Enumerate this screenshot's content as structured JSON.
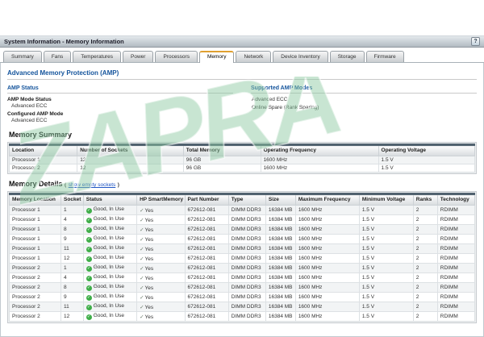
{
  "window": {
    "title": "System Information - Memory Information",
    "help_label": "?"
  },
  "tabs": [
    {
      "label": "Summary"
    },
    {
      "label": "Fans"
    },
    {
      "label": "Temperatures"
    },
    {
      "label": "Power"
    },
    {
      "label": "Processors"
    },
    {
      "label": "Memory",
      "active": true
    },
    {
      "label": "Network"
    },
    {
      "label": "Device Inventory"
    },
    {
      "label": "Storage"
    },
    {
      "label": "Firmware"
    }
  ],
  "amp": {
    "heading": "Advanced Memory Protection (AMP)",
    "status": {
      "heading": "AMP Status",
      "fields": [
        {
          "label": "AMP Mode Status",
          "value": "Advanced ECC"
        },
        {
          "label": "Configured AMP Mode",
          "value": "Advanced ECC"
        }
      ]
    },
    "supported": {
      "heading": "Supported AMP Modes",
      "modes": [
        {
          "name": "Advanced ECC"
        },
        {
          "name": "Online Spare (Rank Sparing)"
        }
      ]
    }
  },
  "memory_summary": {
    "heading": "Memory Summary",
    "columns": [
      {
        "label": "Location"
      },
      {
        "label": "Number of Sockets"
      },
      {
        "label": "Total Memory"
      },
      {
        "label": "Operating Frequency"
      },
      {
        "label": "Operating Voltage"
      }
    ],
    "rows": [
      {
        "location": "Processor 1",
        "sockets": "12",
        "total": "96 GB",
        "freq": "1600 MHz",
        "volt": "1.5 V"
      },
      {
        "location": "Processor 2",
        "sockets": "12",
        "total": "96 GB",
        "freq": "1600 MHz",
        "volt": "1.5 V"
      }
    ]
  },
  "memory_details": {
    "heading": "Memory Details",
    "paren_open": "(",
    "link_label": "show empty sockets",
    "paren_close": ")",
    "columns": [
      {
        "label": "Memory Location"
      },
      {
        "label": "Socket"
      },
      {
        "label": "Status"
      },
      {
        "label": "HP SmartMemory"
      },
      {
        "label": "Part Number"
      },
      {
        "label": "Type"
      },
      {
        "label": "Size"
      },
      {
        "label": "Maximum Frequency"
      },
      {
        "label": "Minimum Voltage"
      },
      {
        "label": "Ranks"
      },
      {
        "label": "Technology"
      }
    ],
    "rows": [
      {
        "location": "Processor 1",
        "socket": "1",
        "status": "Good, In Use",
        "smart": "Yes",
        "part": "672612-081",
        "type": "DIMM DDR3",
        "size": "16384 MB",
        "freq": "1600 MHz",
        "volt": "1.5 V",
        "ranks": "2",
        "tech": "RDIMM"
      },
      {
        "location": "Processor 1",
        "socket": "4",
        "status": "Good, In Use",
        "smart": "Yes",
        "part": "672612-081",
        "type": "DIMM DDR3",
        "size": "16384 MB",
        "freq": "1600 MHz",
        "volt": "1.5 V",
        "ranks": "2",
        "tech": "RDIMM"
      },
      {
        "location": "Processor 1",
        "socket": "8",
        "status": "Good, In Use",
        "smart": "Yes",
        "part": "672612-081",
        "type": "DIMM DDR3",
        "size": "16384 MB",
        "freq": "1600 MHz",
        "volt": "1.5 V",
        "ranks": "2",
        "tech": "RDIMM"
      },
      {
        "location": "Processor 1",
        "socket": "9",
        "status": "Good, In Use",
        "smart": "Yes",
        "part": "672612-081",
        "type": "DIMM DDR3",
        "size": "16384 MB",
        "freq": "1600 MHz",
        "volt": "1.5 V",
        "ranks": "2",
        "tech": "RDIMM"
      },
      {
        "location": "Processor 1",
        "socket": "11",
        "status": "Good, In Use",
        "smart": "Yes",
        "part": "672612-081",
        "type": "DIMM DDR3",
        "size": "16384 MB",
        "freq": "1600 MHz",
        "volt": "1.5 V",
        "ranks": "2",
        "tech": "RDIMM"
      },
      {
        "location": "Processor 1",
        "socket": "12",
        "status": "Good, In Use",
        "smart": "Yes",
        "part": "672612-081",
        "type": "DIMM DDR3",
        "size": "16384 MB",
        "freq": "1600 MHz",
        "volt": "1.5 V",
        "ranks": "2",
        "tech": "RDIMM"
      },
      {
        "location": "Processor 2",
        "socket": "1",
        "status": "Good, In Use",
        "smart": "Yes",
        "part": "672612-081",
        "type": "DIMM DDR3",
        "size": "16384 MB",
        "freq": "1600 MHz",
        "volt": "1.5 V",
        "ranks": "2",
        "tech": "RDIMM"
      },
      {
        "location": "Processor 2",
        "socket": "4",
        "status": "Good, In Use",
        "smart": "Yes",
        "part": "672612-081",
        "type": "DIMM DDR3",
        "size": "16384 MB",
        "freq": "1600 MHz",
        "volt": "1.5 V",
        "ranks": "2",
        "tech": "RDIMM"
      },
      {
        "location": "Processor 2",
        "socket": "8",
        "status": "Good, In Use",
        "smart": "Yes",
        "part": "672612-081",
        "type": "DIMM DDR3",
        "size": "16384 MB",
        "freq": "1600 MHz",
        "volt": "1.5 V",
        "ranks": "2",
        "tech": "RDIMM"
      },
      {
        "location": "Processor 2",
        "socket": "9",
        "status": "Good, In Use",
        "smart": "Yes",
        "part": "672612-081",
        "type": "DIMM DDR3",
        "size": "16384 MB",
        "freq": "1600 MHz",
        "volt": "1.5 V",
        "ranks": "2",
        "tech": "RDIMM"
      },
      {
        "location": "Processor 2",
        "socket": "11",
        "status": "Good, In Use",
        "smart": "Yes",
        "part": "672612-081",
        "type": "DIMM DDR3",
        "size": "16384 MB",
        "freq": "1600 MHz",
        "volt": "1.5 V",
        "ranks": "2",
        "tech": "RDIMM"
      },
      {
        "location": "Processor 2",
        "socket": "12",
        "status": "Good, In Use",
        "smart": "Yes",
        "part": "672612-081",
        "type": "DIMM DDR3",
        "size": "16384 MB",
        "freq": "1600 MHz",
        "volt": "1.5 V",
        "ranks": "2",
        "tech": "RDIMM"
      }
    ]
  },
  "watermark": {
    "text": "ZAPRA"
  },
  "colors": {
    "tab_accent": "#e0a030",
    "heading_blue": "#14549c",
    "status_green": "#3fae49",
    "link_blue": "#1f55c4",
    "table_header_bar": "#51626f",
    "watermark_green": "#8cc8a0"
  }
}
